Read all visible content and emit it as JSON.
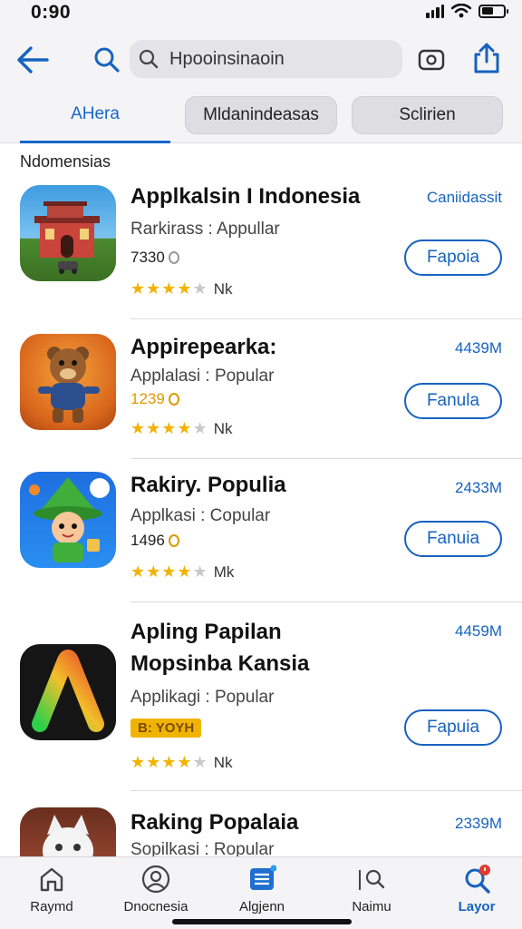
{
  "status_bar": {
    "time": "0:90"
  },
  "header": {
    "search": {
      "value": "Hpooinsinaoin",
      "placeholder": "Hpooinsinaoin"
    },
    "tabs": [
      {
        "label": "AHera",
        "active": true
      },
      {
        "label": "Mldanindeasas",
        "active": false
      },
      {
        "label": "Sclirien",
        "active": false
      }
    ]
  },
  "section": {
    "label": "Ndomensias"
  },
  "apps": [
    {
      "name_line1": "Applkalsin I Indonesia",
      "name_line2": "",
      "meta": "Rarkirass : Appullar",
      "count": "7330",
      "count_color": "grey",
      "badge": "",
      "rating": 4,
      "rating_suffix": "Nk",
      "size": "Caniidassit",
      "button": "Fapoia",
      "icon": "house-icon"
    },
    {
      "name_line1": "Appirepearka:",
      "name_line2": "",
      "meta": "Applalasi : Popular",
      "count": "1239",
      "count_color": "gold",
      "badge": "",
      "rating": 4,
      "rating_suffix": "Nk",
      "size": "4439M",
      "button": "Fanula",
      "icon": "bear-icon"
    },
    {
      "name_line1": "Rakiry. Populia",
      "name_line2": "",
      "meta": "Applkasi : Copular",
      "count": "1496",
      "count_color": "gold",
      "badge": "",
      "rating": 4,
      "rating_suffix": "Mk",
      "size": "2433M",
      "button": "Fanuia",
      "icon": "wizard-icon"
    },
    {
      "name_line1": "Apling Papilan",
      "name_line2": "Mopsinba Kansia",
      "meta": "Applikagi : Popular",
      "count": "",
      "count_color": "",
      "badge": "B: YOYH",
      "rating": 4,
      "rating_suffix": "Nk",
      "size": "4459M",
      "button": "Fapuia",
      "icon": "gradient-a-icon"
    },
    {
      "name_line1": "Raking Popalaia",
      "name_line2": "",
      "meta": "Sopilkasi : Ropular",
      "count": "",
      "count_color": "",
      "badge": "",
      "rating": 0,
      "rating_suffix": "",
      "size": "2339M",
      "button": "",
      "icon": "cat-icon"
    }
  ],
  "bottom_nav": [
    {
      "label": "Raymd",
      "icon": "home-icon",
      "active": false
    },
    {
      "label": "Dnocnesia",
      "icon": "person-icon",
      "active": false
    },
    {
      "label": "Algjenn",
      "icon": "list-icon",
      "active": false
    },
    {
      "label": "Naimu",
      "icon": "search-icon",
      "active": false
    },
    {
      "label": "Layor",
      "icon": "search-icon",
      "active": true
    }
  ],
  "colors": {
    "accent": "#1762c0",
    "star": "#f2b300",
    "badge": "#f0b400"
  }
}
